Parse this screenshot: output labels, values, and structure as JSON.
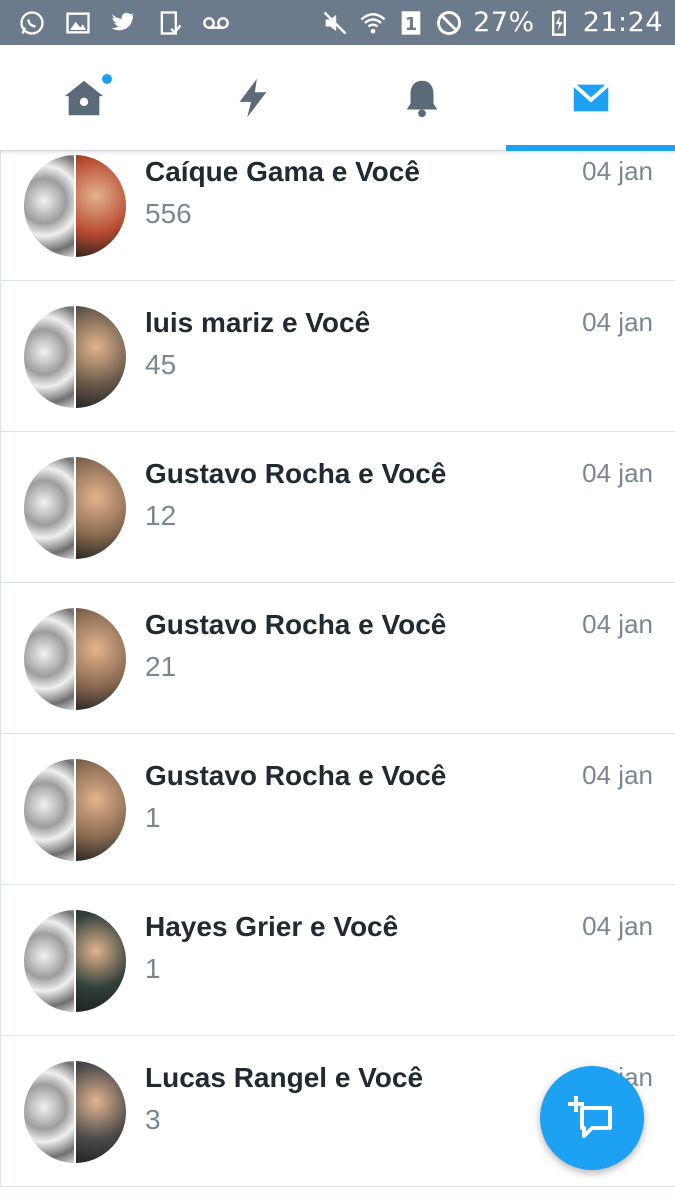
{
  "status_bar": {
    "battery": "27%",
    "time": "21:24",
    "sim_slot": "1",
    "icons_left": [
      "whatsapp-icon",
      "image-icon",
      "twitter-icon",
      "clipboard-check-icon",
      "voicemail-icon"
    ],
    "icons_right": [
      "mute-icon",
      "wifi-icon",
      "sim-icon",
      "block-icon",
      "battery-icon"
    ]
  },
  "tabs": [
    {
      "name": "home",
      "icon": "home-icon",
      "active": false,
      "has_dot": true
    },
    {
      "name": "moments",
      "icon": "lightning-icon",
      "active": false
    },
    {
      "name": "notifications",
      "icon": "bell-icon",
      "active": false
    },
    {
      "name": "messages",
      "icon": "envelope-icon",
      "active": true
    }
  ],
  "conversations": [
    {
      "name": "Caíque Gama e Você",
      "preview": "556",
      "date": "04 jan",
      "avatar_color": "#b84a30"
    },
    {
      "name": "luis mariz e Você",
      "preview": "45",
      "date": "04 jan",
      "avatar_color": "#6a5a4a"
    },
    {
      "name": "Gustavo Rocha e Você",
      "preview": "12",
      "date": "04 jan",
      "avatar_color": "#8a6a50"
    },
    {
      "name": "Gustavo Rocha e Você",
      "preview": "21",
      "date": "04 jan",
      "avatar_color": "#8a6a50"
    },
    {
      "name": "Gustavo Rocha e Você",
      "preview": "1",
      "date": "04 jan",
      "avatar_color": "#8a6a50"
    },
    {
      "name": "Hayes Grier e Você",
      "preview": "1",
      "date": "04 jan",
      "avatar_color": "#2f3f3a"
    },
    {
      "name": "Lucas Rangel e Você",
      "preview": "3",
      "date": "04 jan",
      "avatar_color": "#4a4a4a"
    }
  ],
  "fab": {
    "icon": "new-message-icon"
  },
  "colors": {
    "accent": "#1da1f2",
    "status_bar": "#6b7b8c",
    "tab_icon": "#5b6a78"
  }
}
